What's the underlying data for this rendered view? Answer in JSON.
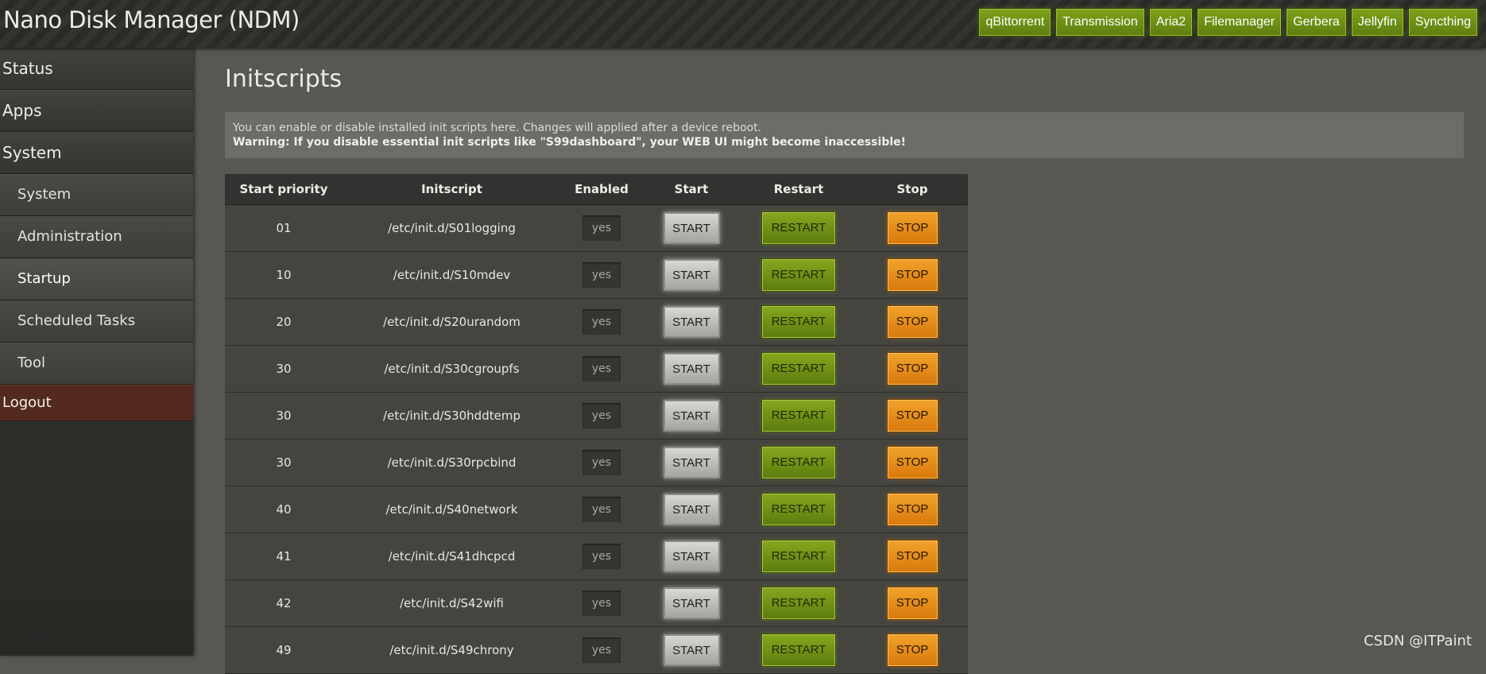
{
  "app": {
    "title": "Nano Disk Manager (NDM)"
  },
  "quicklinks": [
    "qBittorrent",
    "Transmission",
    "Aria2",
    "Filemanager",
    "Gerbera",
    "Jellyfin",
    "Syncthing"
  ],
  "sidebar": {
    "items": [
      {
        "label": "Status",
        "type": "top"
      },
      {
        "label": "Apps",
        "type": "top"
      },
      {
        "label": "System",
        "type": "top"
      },
      {
        "label": "System",
        "type": "sub"
      },
      {
        "label": "Administration",
        "type": "sub"
      },
      {
        "label": "Startup",
        "type": "sub",
        "active": true
      },
      {
        "label": "Scheduled Tasks",
        "type": "sub"
      },
      {
        "label": "Tool",
        "type": "sub"
      }
    ],
    "logout": "Logout"
  },
  "main": {
    "title": "Initscripts",
    "notice": {
      "line1": "You can enable or disable installed init scripts here. Changes will applied after a device reboot.",
      "warning": "Warning: If you disable essential init scripts like \"S99dashboard\", your WEB UI might become inaccessible!"
    },
    "table": {
      "headers": [
        "Start priority",
        "Initscript",
        "Enabled",
        "Start",
        "Restart",
        "Stop"
      ],
      "rows": [
        {
          "priority": "01",
          "script": "/etc/init.d/S01logging",
          "enabled": "yes"
        },
        {
          "priority": "10",
          "script": "/etc/init.d/S10mdev",
          "enabled": "yes"
        },
        {
          "priority": "20",
          "script": "/etc/init.d/S20urandom",
          "enabled": "yes"
        },
        {
          "priority": "30",
          "script": "/etc/init.d/S30cgroupfs",
          "enabled": "yes"
        },
        {
          "priority": "30",
          "script": "/etc/init.d/S30hddtemp",
          "enabled": "yes"
        },
        {
          "priority": "30",
          "script": "/etc/init.d/S30rpcbind",
          "enabled": "yes"
        },
        {
          "priority": "40",
          "script": "/etc/init.d/S40network",
          "enabled": "yes"
        },
        {
          "priority": "41",
          "script": "/etc/init.d/S41dhcpcd",
          "enabled": "yes"
        },
        {
          "priority": "42",
          "script": "/etc/init.d/S42wifi",
          "enabled": "yes"
        },
        {
          "priority": "49",
          "script": "/etc/init.d/S49chrony",
          "enabled": "yes"
        }
      ],
      "buttons": {
        "start": "START",
        "restart": "RESTART",
        "stop": "STOP"
      }
    }
  },
  "watermark": "CSDN @ITPaint",
  "colors": {
    "accent_green": "#6a8c14",
    "stop_orange": "#e58a18",
    "logout_bg": "#552a1e"
  }
}
